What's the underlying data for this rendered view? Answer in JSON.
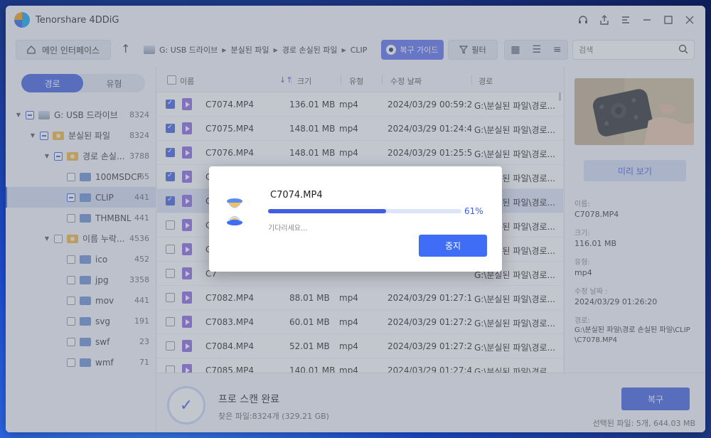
{
  "app": {
    "title": "Tenorshare 4DDiG"
  },
  "toolbar": {
    "home_label": "메인 인터페이스",
    "breadcrumbs": [
      "G: USB 드라이브",
      "분실된 파일",
      "경로 손실된 파일",
      "CLIP"
    ],
    "guide_label": "복구 가이드",
    "filter_label": "필터",
    "search_placeholder": "검색"
  },
  "sidebar": {
    "tabs": [
      "경로",
      "유형"
    ],
    "tree": [
      {
        "label": "G: USB 드라이브",
        "count": "8324"
      },
      {
        "label": "분실된 파일",
        "count": "8324"
      },
      {
        "label": "경로 손실...",
        "count": "3788"
      },
      {
        "label": "100MSDCF",
        "count": "65"
      },
      {
        "label": "CLIP",
        "count": "441"
      },
      {
        "label": "THMBNL",
        "count": "441"
      },
      {
        "label": "이름 누락...",
        "count": "4536"
      },
      {
        "label": "ico",
        "count": "452"
      },
      {
        "label": "jpg",
        "count": "3358"
      },
      {
        "label": "mov",
        "count": "441"
      },
      {
        "label": "svg",
        "count": "191"
      },
      {
        "label": "swf",
        "count": "23"
      },
      {
        "label": "wmf",
        "count": "71"
      }
    ]
  },
  "table": {
    "columns": [
      "이름",
      "크기",
      "유형",
      "수정 날짜",
      "경로"
    ],
    "rows": [
      {
        "name": "C7074.MP4",
        "size": "136.01 MB",
        "type": "mp4",
        "date": "2024/03/29 00:59:22",
        "path": "G:\\분실된 파일\\경로..."
      },
      {
        "name": "C7075.MP4",
        "size": "148.01 MB",
        "type": "mp4",
        "date": "2024/03/29 01:24:48",
        "path": "G:\\분실된 파일\\경로..."
      },
      {
        "name": "C7076.MP4",
        "size": "148.01 MB",
        "type": "mp4",
        "date": "2024/03/29 01:25:52",
        "path": "G:\\분실된 파일\\경로..."
      },
      {
        "name": "C7",
        "size": "",
        "type": "",
        "date": "",
        "path": "G:\\분실된 파일\\경로..."
      },
      {
        "name": "C7",
        "size": "",
        "type": "",
        "date": "",
        "path": "G:\\분실된 파일\\경로..."
      },
      {
        "name": "C7",
        "size": "",
        "type": "",
        "date": "",
        "path": "G:\\분실된 파일\\경로..."
      },
      {
        "name": "C7",
        "size": "",
        "type": "",
        "date": "",
        "path": "G:\\분실된 파일\\경로..."
      },
      {
        "name": "C7",
        "size": "",
        "type": "",
        "date": "",
        "path": "G:\\분실된 파일\\경로..."
      },
      {
        "name": "C7082.MP4",
        "size": "88.01 MB",
        "type": "mp4",
        "date": "2024/03/29 01:27:14",
        "path": "G:\\분실된 파일\\경로..."
      },
      {
        "name": "C7083.MP4",
        "size": "60.01 MB",
        "type": "mp4",
        "date": "2024/03/29 01:27:20",
        "path": "G:\\분실된 파일\\경로..."
      },
      {
        "name": "C7084.MP4",
        "size": "52.01 MB",
        "type": "mp4",
        "date": "2024/03/29 01:27:26",
        "path": "G:\\분실된 파일\\경로..."
      },
      {
        "name": "C7085.MP4",
        "size": "140.01 MB",
        "type": "mp4",
        "date": "2024/03/29 01:27:40",
        "path": "G:\\분실된 파일\\경로..."
      }
    ]
  },
  "preview": {
    "button_label": "미리 보기",
    "name_label": "이름:",
    "name": "C7078.MP4",
    "size_label": "크기:",
    "size": "116.01 MB",
    "type_label": "유형:",
    "type": "mp4",
    "date_label": "수정 날짜 :",
    "date": "2024/03/29 01:26:20",
    "path_label": "경로:",
    "path": "G:\\분실된 파일\\경로 손실된 파일\\CLIP\\C7078.MP4"
  },
  "footer": {
    "status_title": "프로 스캔 완료",
    "status_sub": "찾은 파일:8324개 (329.21 GB)",
    "recover_label": "복구",
    "selected_text": "선택된 파일: 5개, 644.03 MB"
  },
  "dialog": {
    "filename": "C7074.MP4",
    "progress_percent": 61,
    "progress_text": "61%",
    "wait_text": "기다리세요...",
    "stop_label": "중지"
  },
  "colors": {
    "accent": "#3f5ee0",
    "guide": "#5b6ff0",
    "folder": "#f5b73b"
  }
}
